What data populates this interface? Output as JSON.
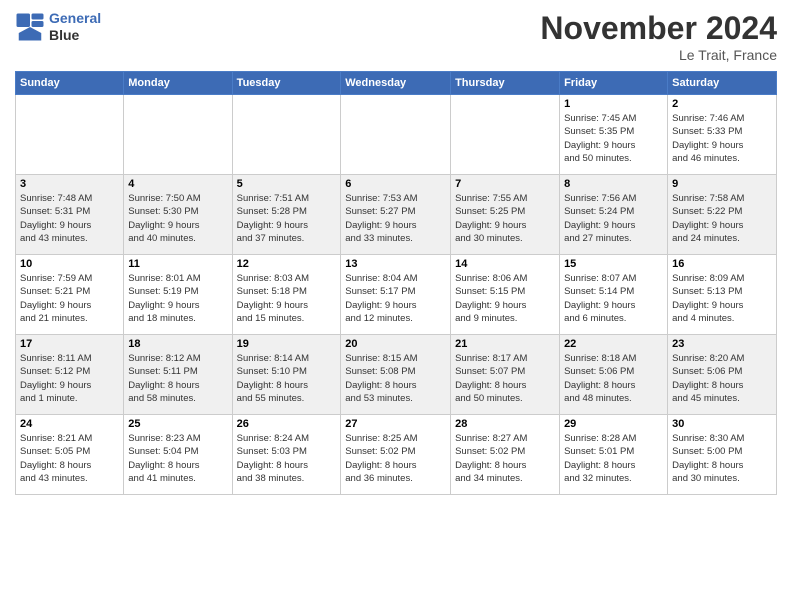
{
  "header": {
    "logo_line1": "General",
    "logo_line2": "Blue",
    "month": "November 2024",
    "location": "Le Trait, France"
  },
  "weekdays": [
    "Sunday",
    "Monday",
    "Tuesday",
    "Wednesday",
    "Thursday",
    "Friday",
    "Saturday"
  ],
  "weeks": [
    [
      {
        "day": "",
        "info": ""
      },
      {
        "day": "",
        "info": ""
      },
      {
        "day": "",
        "info": ""
      },
      {
        "day": "",
        "info": ""
      },
      {
        "day": "",
        "info": ""
      },
      {
        "day": "1",
        "info": "Sunrise: 7:45 AM\nSunset: 5:35 PM\nDaylight: 9 hours\nand 50 minutes."
      },
      {
        "day": "2",
        "info": "Sunrise: 7:46 AM\nSunset: 5:33 PM\nDaylight: 9 hours\nand 46 minutes."
      }
    ],
    [
      {
        "day": "3",
        "info": "Sunrise: 7:48 AM\nSunset: 5:31 PM\nDaylight: 9 hours\nand 43 minutes."
      },
      {
        "day": "4",
        "info": "Sunrise: 7:50 AM\nSunset: 5:30 PM\nDaylight: 9 hours\nand 40 minutes."
      },
      {
        "day": "5",
        "info": "Sunrise: 7:51 AM\nSunset: 5:28 PM\nDaylight: 9 hours\nand 37 minutes."
      },
      {
        "day": "6",
        "info": "Sunrise: 7:53 AM\nSunset: 5:27 PM\nDaylight: 9 hours\nand 33 minutes."
      },
      {
        "day": "7",
        "info": "Sunrise: 7:55 AM\nSunset: 5:25 PM\nDaylight: 9 hours\nand 30 minutes."
      },
      {
        "day": "8",
        "info": "Sunrise: 7:56 AM\nSunset: 5:24 PM\nDaylight: 9 hours\nand 27 minutes."
      },
      {
        "day": "9",
        "info": "Sunrise: 7:58 AM\nSunset: 5:22 PM\nDaylight: 9 hours\nand 24 minutes."
      }
    ],
    [
      {
        "day": "10",
        "info": "Sunrise: 7:59 AM\nSunset: 5:21 PM\nDaylight: 9 hours\nand 21 minutes."
      },
      {
        "day": "11",
        "info": "Sunrise: 8:01 AM\nSunset: 5:19 PM\nDaylight: 9 hours\nand 18 minutes."
      },
      {
        "day": "12",
        "info": "Sunrise: 8:03 AM\nSunset: 5:18 PM\nDaylight: 9 hours\nand 15 minutes."
      },
      {
        "day": "13",
        "info": "Sunrise: 8:04 AM\nSunset: 5:17 PM\nDaylight: 9 hours\nand 12 minutes."
      },
      {
        "day": "14",
        "info": "Sunrise: 8:06 AM\nSunset: 5:15 PM\nDaylight: 9 hours\nand 9 minutes."
      },
      {
        "day": "15",
        "info": "Sunrise: 8:07 AM\nSunset: 5:14 PM\nDaylight: 9 hours\nand 6 minutes."
      },
      {
        "day": "16",
        "info": "Sunrise: 8:09 AM\nSunset: 5:13 PM\nDaylight: 9 hours\nand 4 minutes."
      }
    ],
    [
      {
        "day": "17",
        "info": "Sunrise: 8:11 AM\nSunset: 5:12 PM\nDaylight: 9 hours\nand 1 minute."
      },
      {
        "day": "18",
        "info": "Sunrise: 8:12 AM\nSunset: 5:11 PM\nDaylight: 8 hours\nand 58 minutes."
      },
      {
        "day": "19",
        "info": "Sunrise: 8:14 AM\nSunset: 5:10 PM\nDaylight: 8 hours\nand 55 minutes."
      },
      {
        "day": "20",
        "info": "Sunrise: 8:15 AM\nSunset: 5:08 PM\nDaylight: 8 hours\nand 53 minutes."
      },
      {
        "day": "21",
        "info": "Sunrise: 8:17 AM\nSunset: 5:07 PM\nDaylight: 8 hours\nand 50 minutes."
      },
      {
        "day": "22",
        "info": "Sunrise: 8:18 AM\nSunset: 5:06 PM\nDaylight: 8 hours\nand 48 minutes."
      },
      {
        "day": "23",
        "info": "Sunrise: 8:20 AM\nSunset: 5:06 PM\nDaylight: 8 hours\nand 45 minutes."
      }
    ],
    [
      {
        "day": "24",
        "info": "Sunrise: 8:21 AM\nSunset: 5:05 PM\nDaylight: 8 hours\nand 43 minutes."
      },
      {
        "day": "25",
        "info": "Sunrise: 8:23 AM\nSunset: 5:04 PM\nDaylight: 8 hours\nand 41 minutes."
      },
      {
        "day": "26",
        "info": "Sunrise: 8:24 AM\nSunset: 5:03 PM\nDaylight: 8 hours\nand 38 minutes."
      },
      {
        "day": "27",
        "info": "Sunrise: 8:25 AM\nSunset: 5:02 PM\nDaylight: 8 hours\nand 36 minutes."
      },
      {
        "day": "28",
        "info": "Sunrise: 8:27 AM\nSunset: 5:02 PM\nDaylight: 8 hours\nand 34 minutes."
      },
      {
        "day": "29",
        "info": "Sunrise: 8:28 AM\nSunset: 5:01 PM\nDaylight: 8 hours\nand 32 minutes."
      },
      {
        "day": "30",
        "info": "Sunrise: 8:30 AM\nSunset: 5:00 PM\nDaylight: 8 hours\nand 30 minutes."
      }
    ]
  ]
}
